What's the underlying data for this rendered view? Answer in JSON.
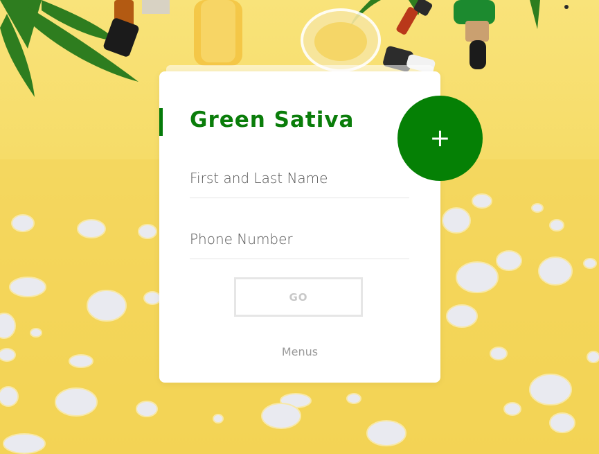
{
  "brand": {
    "title": "Green Sativa",
    "accent_color": "#0a7d0a"
  },
  "form": {
    "name_label": "First and Last Name",
    "phone_label": "Phone Number",
    "go_label": "GO",
    "menus_label": "Menus"
  },
  "toggle": {
    "plus_label": "+",
    "color": "#058005"
  },
  "icons": {
    "plus": "plus-icon"
  }
}
